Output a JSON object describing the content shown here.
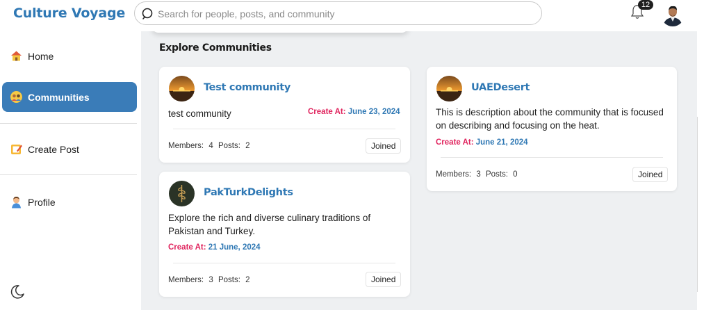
{
  "app": {
    "title": "Culture Voyage"
  },
  "search": {
    "placeholder": "Search for people, posts, and community"
  },
  "notifications": {
    "count": "12"
  },
  "sidebar": {
    "items": [
      {
        "label": "Home",
        "icon": "home-icon"
      },
      {
        "label": "Communities",
        "icon": "communities-icon",
        "active": true
      },
      {
        "label": "Create Post",
        "icon": "create-post-icon"
      },
      {
        "label": "Profile",
        "icon": "profile-icon"
      }
    ],
    "theme_icon": "moon-icon"
  },
  "main": {
    "section_title": "Explore Communities",
    "communities": [
      {
        "name": "Test community",
        "description": "test community",
        "created_label": "Create At:",
        "created_value": "June 23, 2024",
        "members_label": "Members:",
        "members": "4",
        "posts_label": "Posts:",
        "posts": "2",
        "status": "Joined"
      },
      {
        "name": "UAEDesert",
        "description": "This is description about the community that is focused on describing and focusing on the heat.",
        "created_label": "Create At:",
        "created_value": "June 21, 2024",
        "members_label": "Members:",
        "members": "3",
        "posts_label": "Posts:",
        "posts": "0",
        "status": "Joined"
      },
      {
        "name": "PakTurkDelights",
        "description": "Explore the rich and diverse culinary traditions of Pakistan and Turkey.",
        "created_label": "Create At:",
        "created_value": "21 June, 2024",
        "members_label": "Members:",
        "members": "3",
        "posts_label": "Posts:",
        "posts": "2",
        "status": "Joined"
      }
    ]
  },
  "colors": {
    "brand": "#2f78b4",
    "active_nav": "#3a7cb8",
    "created_label": "#e0245e",
    "main_bg": "#eef0f2"
  }
}
